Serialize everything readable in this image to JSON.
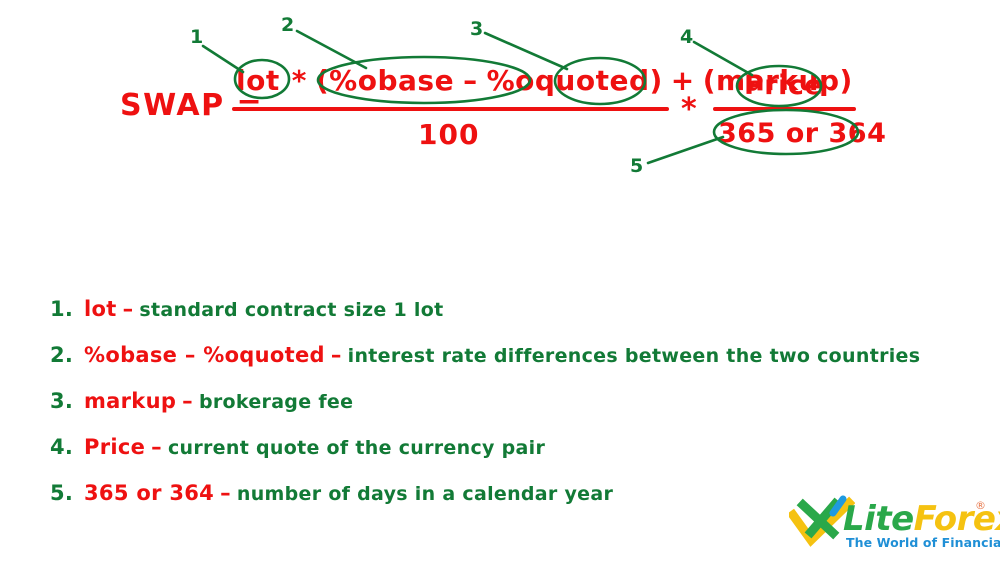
{
  "formula": {
    "label": "SWAP =",
    "numerator": {
      "lot": "lot",
      "op_multiply": "*",
      "open_paren": "(",
      "pct_base": "%obase",
      "op_minus": "–",
      "pct_quoted": "%oquoted",
      "close_paren": ")",
      "op_plus": "+",
      "open_paren2": "(",
      "markup": "markup",
      "close_paren2": ")"
    },
    "denominator": "100",
    "multiply_between_fractions": "*",
    "right_numerator": "Price",
    "right_denominator": "365 or 364"
  },
  "callouts": [
    {
      "number": "1",
      "target": "lot"
    },
    {
      "number": "2",
      "target": "%obase – %oquoted"
    },
    {
      "number": "3",
      "target": "markup"
    },
    {
      "number": "4",
      "target": "Price"
    },
    {
      "number": "5",
      "target": "365 or 364"
    }
  ],
  "legend": [
    {
      "number": "1.",
      "term": "lot",
      "dash": "–",
      "description": "standard contract size 1 lot"
    },
    {
      "number": "2.",
      "term": "%obase – %oquoted",
      "dash": "–",
      "description": "interest rate differences between the two countries"
    },
    {
      "number": "3.",
      "term": "markup",
      "dash": "–",
      "description": "brokerage fee"
    },
    {
      "number": "4.",
      "term": "Price",
      "dash": "–",
      "description": "current quote of the currency pair"
    },
    {
      "number": "5.",
      "term": "365 or 364",
      "dash": "–",
      "description": "number of days in a calendar year"
    }
  ],
  "logo": {
    "name_part1": "Lite",
    "name_part2": "Forex",
    "registered": "®",
    "tagline": "The World of Financial Freedom"
  },
  "colors": {
    "red": "#ee1111",
    "green": "#127a36",
    "logo_green": "#2aa84a",
    "logo_yellow": "#f5c211",
    "logo_blue": "#1f8fd6",
    "background": "#ffffff"
  }
}
